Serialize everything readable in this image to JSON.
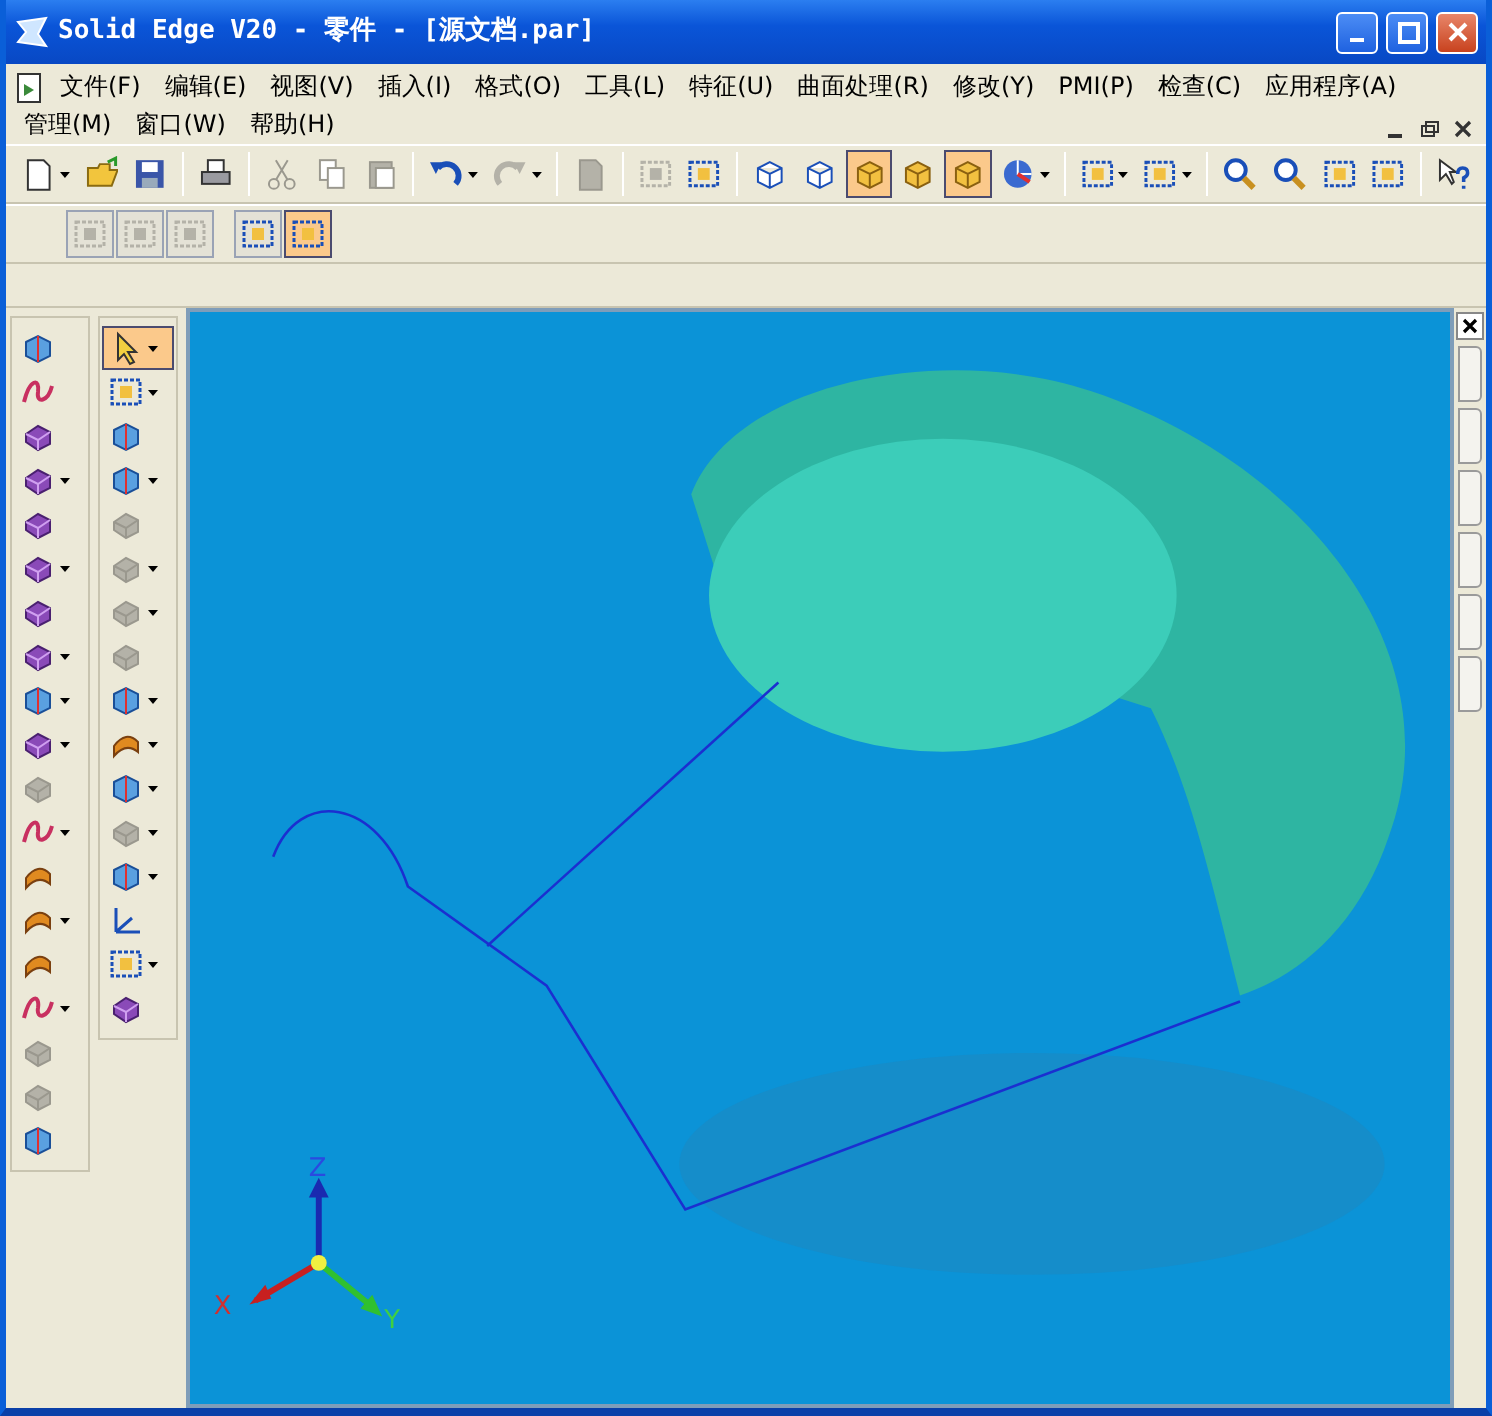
{
  "window": {
    "title": "Solid Edge V20 - 零件 - [源文档.par]"
  },
  "menu": [
    "文件(F)",
    "编辑(E)",
    "视图(V)",
    "插入(I)",
    "格式(O)",
    "工具(L)",
    "特征(U)",
    "曲面处理(R)",
    "修改(Y)",
    "PMI(P)",
    "检查(C)",
    "应用程序(A)",
    "管理(M)",
    "窗口(W)",
    "帮助(H)"
  ],
  "main_toolbar": [
    {
      "dropdown": true,
      "disabled": false,
      "selected": false
    },
    {
      "dropdown": false,
      "disabled": false,
      "selected": false
    },
    {
      "dropdown": false,
      "disabled": false,
      "selected": false
    },
    {
      "dropdown": false,
      "disabled": false,
      "selected": false
    },
    {
      "dropdown": false,
      "disabled": true,
      "selected": false
    },
    {
      "dropdown": false,
      "disabled": true,
      "selected": false
    },
    {
      "dropdown": false,
      "disabled": true,
      "selected": false
    },
    {
      "dropdown": true,
      "disabled": false,
      "selected": false
    },
    {
      "dropdown": true,
      "disabled": true,
      "selected": false
    },
    {
      "dropdown": false,
      "disabled": true,
      "selected": false
    },
    {
      "dropdown": false,
      "disabled": true,
      "selected": false
    },
    {
      "dropdown": false,
      "disabled": false,
      "selected": false
    },
    {
      "dropdown": false,
      "disabled": false,
      "selected": false
    },
    {
      "dropdown": false,
      "disabled": false,
      "selected": false
    },
    {
      "dropdown": false,
      "disabled": false,
      "selected": true
    },
    {
      "dropdown": false,
      "disabled": false,
      "selected": false
    },
    {
      "dropdown": false,
      "disabled": false,
      "selected": true
    },
    {
      "dropdown": true,
      "disabled": false,
      "selected": false
    },
    {
      "dropdown": true,
      "disabled": false,
      "selected": false
    },
    {
      "dropdown": true,
      "disabled": false,
      "selected": false
    },
    {
      "dropdown": false,
      "disabled": false,
      "selected": false
    },
    {
      "dropdown": false,
      "disabled": false,
      "selected": false
    },
    {
      "dropdown": false,
      "disabled": false,
      "selected": false
    },
    {
      "dropdown": false,
      "disabled": false,
      "selected": false
    },
    {
      "dropdown": false,
      "disabled": false,
      "selected": false
    }
  ],
  "sub_toolbar": [
    {
      "dropdown": false,
      "disabled": true,
      "selected": false
    },
    {
      "dropdown": false,
      "disabled": true,
      "selected": false
    },
    {
      "dropdown": false,
      "disabled": true,
      "selected": false
    },
    {
      "dropdown": false,
      "disabled": false,
      "selected": false
    },
    {
      "dropdown": false,
      "disabled": false,
      "selected": true
    }
  ],
  "feature_toolbar_1": [
    {
      "dropdown": false,
      "disabled": false,
      "selected": false
    },
    {
      "dropdown": false,
      "disabled": false,
      "selected": false
    },
    {
      "dropdown": false,
      "disabled": false,
      "selected": false
    },
    {
      "dropdown": true,
      "disabled": false,
      "selected": false
    },
    {
      "dropdown": false,
      "disabled": false,
      "selected": false
    },
    {
      "dropdown": true,
      "disabled": false,
      "selected": false
    },
    {
      "dropdown": false,
      "disabled": false,
      "selected": false
    },
    {
      "dropdown": true,
      "disabled": false,
      "selected": false
    },
    {
      "dropdown": true,
      "disabled": false,
      "selected": false
    },
    {
      "dropdown": true,
      "disabled": false,
      "selected": false
    },
    {
      "dropdown": false,
      "disabled": true,
      "selected": false
    },
    {
      "dropdown": true,
      "disabled": false,
      "selected": false
    },
    {
      "dropdown": false,
      "disabled": false,
      "selected": false
    },
    {
      "dropdown": true,
      "disabled": false,
      "selected": false
    },
    {
      "dropdown": false,
      "disabled": false,
      "selected": false
    },
    {
      "dropdown": true,
      "disabled": false,
      "selected": false
    },
    {
      "dropdown": false,
      "disabled": true,
      "selected": false
    },
    {
      "dropdown": false,
      "disabled": true,
      "selected": false
    },
    {
      "dropdown": false,
      "disabled": false,
      "selected": false
    }
  ],
  "feature_toolbar_2": [
    {
      "dropdown": true,
      "disabled": false,
      "selected": true
    },
    {
      "dropdown": true,
      "disabled": false,
      "selected": false
    },
    {
      "dropdown": false,
      "disabled": false,
      "selected": false
    },
    {
      "dropdown": true,
      "disabled": false,
      "selected": false
    },
    {
      "dropdown": false,
      "disabled": true,
      "selected": false
    },
    {
      "dropdown": true,
      "disabled": true,
      "selected": false
    },
    {
      "dropdown": true,
      "disabled": true,
      "selected": false
    },
    {
      "dropdown": false,
      "disabled": true,
      "selected": false
    },
    {
      "dropdown": true,
      "disabled": false,
      "selected": false
    },
    {
      "dropdown": true,
      "disabled": false,
      "selected": false
    },
    {
      "dropdown": true,
      "disabled": false,
      "selected": false
    },
    {
      "dropdown": true,
      "disabled": true,
      "selected": false
    },
    {
      "dropdown": true,
      "disabled": false,
      "selected": false
    },
    {
      "dropdown": false,
      "disabled": false,
      "selected": false
    },
    {
      "dropdown": true,
      "disabled": false,
      "selected": false
    },
    {
      "dropdown": false,
      "disabled": false,
      "selected": false
    }
  ],
  "viewport": {
    "triad": {
      "x_label": "X",
      "y_label": "Y",
      "z_label": "Z"
    }
  }
}
